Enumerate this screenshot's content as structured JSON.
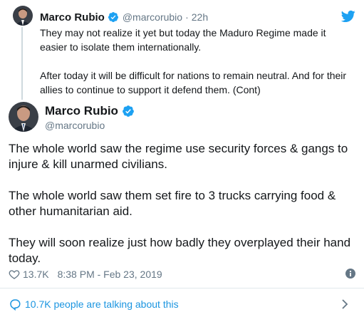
{
  "parent_tweet": {
    "author_name": "Marco Rubio",
    "handle": "@marcorubio",
    "separator": "·",
    "time_ago": "22h",
    "paragraphs": [
      "They may not realize it yet but today the Maduro Regime made it easier to isolate them internationally.",
      "After today it will be difficult for nations to remain neutral. And for their allies to continue to support it defend them. (Cont)"
    ]
  },
  "main_tweet": {
    "author_name": "Marco Rubio",
    "handle": "@marcorubio",
    "paragraphs": [
      "The whole world saw the regime use security forces & gangs to injure & kill unarmed civilians.",
      "The whole world saw them set fire to 3 trucks carrying food & other humanitarian aid.",
      "They will soon realize just how badly they overplayed their hand today."
    ],
    "likes": "13.7K",
    "timestamp": "8:38 PM - Feb 23, 2019"
  },
  "footer": {
    "talking_text": "10.7K people are talking about this"
  },
  "icons": {
    "verified": "verified-badge-icon",
    "brand": "twitter-bird-icon",
    "like": "heart-icon",
    "info": "info-icon",
    "conversation": "speech-bubble-icon",
    "more": "chevron-right-icon"
  },
  "colors": {
    "brand_blue": "#1da1f2",
    "link_blue": "#1b95e0",
    "secondary_text": "#657786",
    "primary_text": "#14171a"
  }
}
